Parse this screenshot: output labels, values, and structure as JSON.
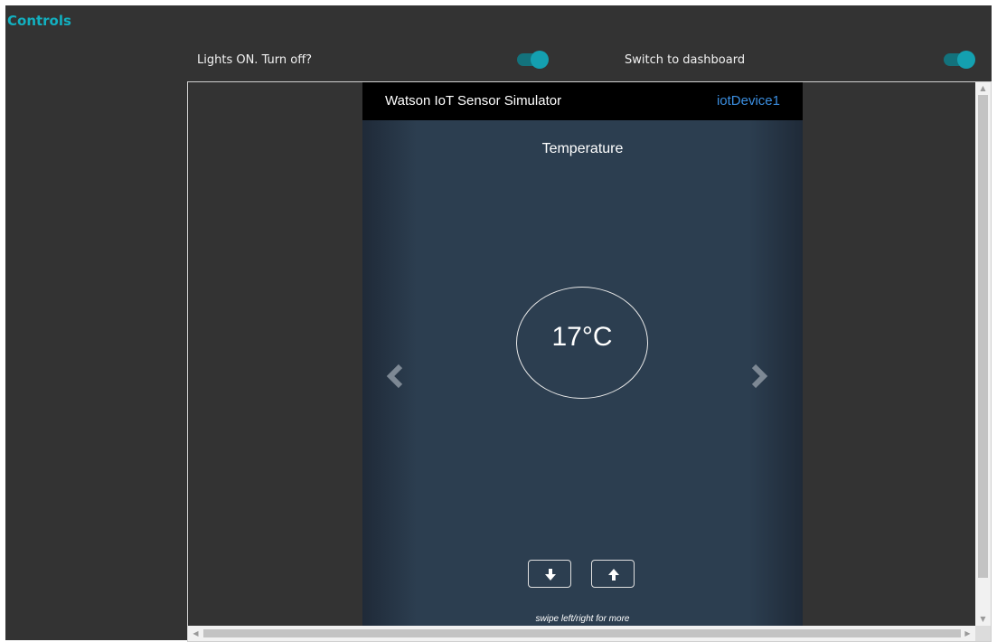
{
  "controls": {
    "title": "Controls",
    "lights_label": "Lights ON. Turn off?",
    "lights_on": true,
    "dashboard_label": "Switch to dashboard",
    "dashboard_on": true
  },
  "simulator": {
    "app_title": "Watson IoT Sensor Simulator",
    "device_id": "iotDevice1",
    "sensor_name": "Temperature",
    "value": "17°C",
    "hint": "swipe left/right for more"
  },
  "icons": {
    "prev": "chevron-left-icon",
    "next": "chevron-right-icon",
    "decrease": "arrow-down-icon",
    "increase": "arrow-up-icon"
  },
  "colors": {
    "accent": "#12b0c0",
    "toggle_track": "#13727c",
    "toggle_knob": "#14a0b0",
    "panel_bg": "#333333",
    "sim_bg": "#2c3e50",
    "device_link": "#3b8ee0"
  }
}
